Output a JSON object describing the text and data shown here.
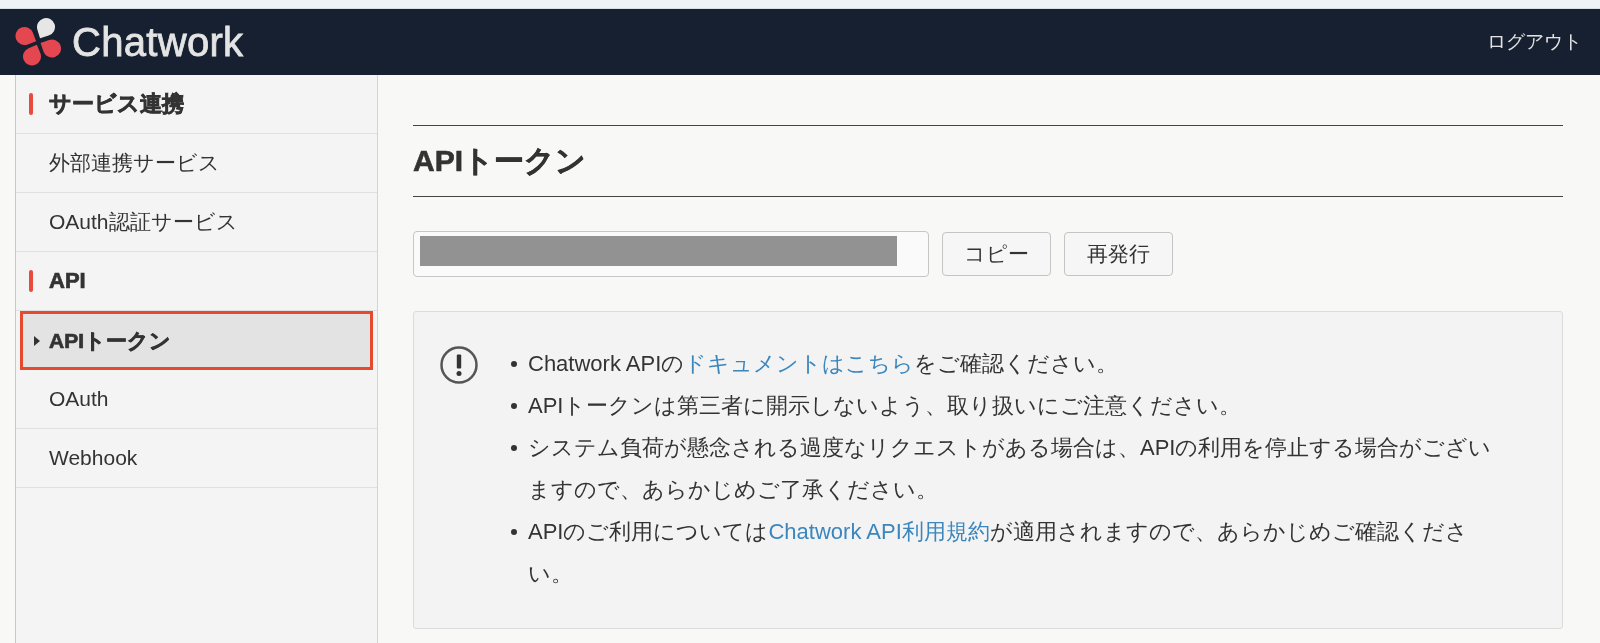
{
  "header": {
    "logo_text": "Chatwork",
    "logout": "ログアウト"
  },
  "sidebar": {
    "sections": [
      {
        "title": "サービス連携",
        "items": [
          {
            "label": "外部連携サービス",
            "selected": false
          },
          {
            "label": "OAuth認証サービス",
            "selected": false
          }
        ]
      },
      {
        "title": "API",
        "items": [
          {
            "label": "APIトークン",
            "selected": true
          },
          {
            "label": "OAuth",
            "selected": false
          },
          {
            "label": "Webhook",
            "selected": false
          }
        ]
      }
    ]
  },
  "main": {
    "title": "APIトークン",
    "token_field": {
      "redacted": true
    },
    "buttons": [
      "コピー",
      "再発行"
    ],
    "notice": {
      "items": [
        {
          "segments": [
            {
              "kind": "text",
              "text": "Chatwork APIの"
            },
            {
              "kind": "link",
              "text": "ドキュメントはこちら"
            },
            {
              "kind": "text",
              "text": "をご確認ください。"
            }
          ]
        },
        {
          "segments": [
            {
              "kind": "text",
              "text": "APIトークンは第三者に開示しないよう、取り扱いにご注意ください。"
            }
          ]
        },
        {
          "segments": [
            {
              "kind": "text",
              "text": "システム負荷が懸念される過度なリクエストがある場合は、APIの利用を停止する場合がございますので、あらかじめご了承ください。"
            }
          ]
        },
        {
          "segments": [
            {
              "kind": "text",
              "text": "APIのご利用については"
            },
            {
              "kind": "link",
              "text": "Chatwork API利用規約"
            },
            {
              "kind": "text",
              "text": "が適用されますので、あらかじめご確認ください。"
            }
          ]
        }
      ]
    }
  }
}
